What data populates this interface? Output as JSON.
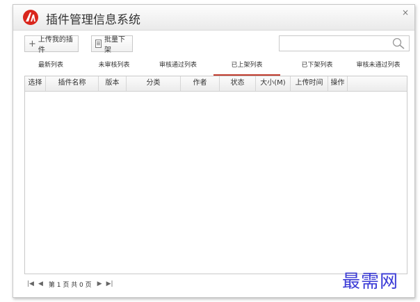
{
  "app": {
    "title": "插件管理信息系统",
    "close_glyph": "×"
  },
  "toolbar": {
    "upload_label": "上传我的插件",
    "batch_label": "批量下架"
  },
  "search": {
    "placeholder": "",
    "value": ""
  },
  "tabs": [
    {
      "label": "最新列表"
    },
    {
      "label": "未审核列表"
    },
    {
      "label": "审核通过列表"
    },
    {
      "label": "已上架列表",
      "active": true
    },
    {
      "label": "已下架列表"
    },
    {
      "label": "审核未通过列表"
    }
  ],
  "table": {
    "columns": [
      "选择",
      "插件名称",
      "版本",
      "分类",
      "作者",
      "状态",
      "大小(M)",
      "上传时间",
      "操作"
    ],
    "rows": []
  },
  "pager": {
    "first": "|◀",
    "prev": "◀",
    "text": "第 1 页 共 0 页",
    "next": "▶",
    "last": "▶|"
  },
  "watermark": "最需网",
  "colors": {
    "accent": "#c0392b",
    "watermark": "#3b3bd6"
  }
}
